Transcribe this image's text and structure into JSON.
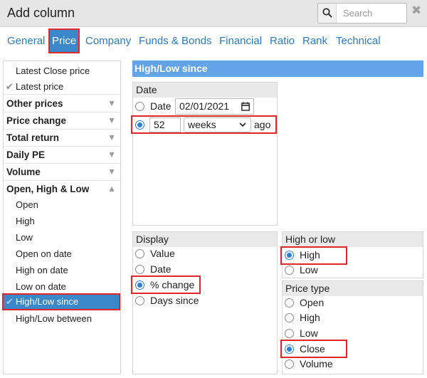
{
  "header": {
    "title": "Add column",
    "search_placeholder": "Search",
    "close_glyph": "✖"
  },
  "tabs": [
    {
      "label": "General",
      "active": false
    },
    {
      "label": "Price",
      "active": true
    },
    {
      "label": "Company",
      "active": false
    },
    {
      "label": "Funds & Bonds",
      "active": false
    },
    {
      "label": "Financial",
      "active": false
    },
    {
      "label": "Ratio",
      "active": false
    },
    {
      "label": "Rank",
      "active": false
    },
    {
      "label": "Technical",
      "active": false
    }
  ],
  "sidebar": {
    "items": [
      {
        "label": "Latest Close price",
        "type": "sub",
        "checked": false
      },
      {
        "label": "Latest price",
        "type": "sub",
        "checked": true
      },
      {
        "label": "Other prices",
        "type": "group",
        "arrow": "▼"
      },
      {
        "label": "Price change",
        "type": "group",
        "arrow": "▼"
      },
      {
        "label": "Total return",
        "type": "group",
        "arrow": "▼"
      },
      {
        "label": "Daily PE",
        "type": "group",
        "arrow": "▼"
      },
      {
        "label": "Volume",
        "type": "group",
        "arrow": "▼"
      },
      {
        "label": "Open, High & Low",
        "type": "group",
        "arrow": "▲"
      },
      {
        "label": "Open",
        "type": "sub"
      },
      {
        "label": "High",
        "type": "sub"
      },
      {
        "label": "Low",
        "type": "sub"
      },
      {
        "label": "Open on date",
        "type": "sub"
      },
      {
        "label": "High on date",
        "type": "sub"
      },
      {
        "label": "Low on date",
        "type": "sub"
      },
      {
        "label": "High/Low since",
        "type": "sub",
        "selected": true,
        "checked": true
      },
      {
        "label": "High/Low between",
        "type": "sub"
      }
    ],
    "check_glyph": "✔"
  },
  "panel": {
    "title": "High/Low since",
    "date_section": {
      "heading": "Date",
      "date_option_label": "Date",
      "date_value": "02/01/2021",
      "ago_number": "52",
      "ago_unit": "weeks",
      "ago_unit_options": [
        "weeks"
      ],
      "ago_suffix": "ago"
    },
    "display_section": {
      "heading": "Display",
      "options": [
        {
          "label": "Value",
          "selected": false
        },
        {
          "label": "Date",
          "selected": false
        },
        {
          "label": "% change",
          "selected": true
        },
        {
          "label": "Days since",
          "selected": false
        }
      ]
    },
    "high_low_section": {
      "heading": "High or low",
      "options": [
        {
          "label": "High",
          "selected": true
        },
        {
          "label": "Low",
          "selected": false
        }
      ]
    },
    "price_type_section": {
      "heading": "Price type",
      "options": [
        {
          "label": "Open",
          "selected": false
        },
        {
          "label": "High",
          "selected": false
        },
        {
          "label": "Low",
          "selected": false
        },
        {
          "label": "Close",
          "selected": true
        },
        {
          "label": "Volume",
          "selected": false
        }
      ]
    }
  }
}
